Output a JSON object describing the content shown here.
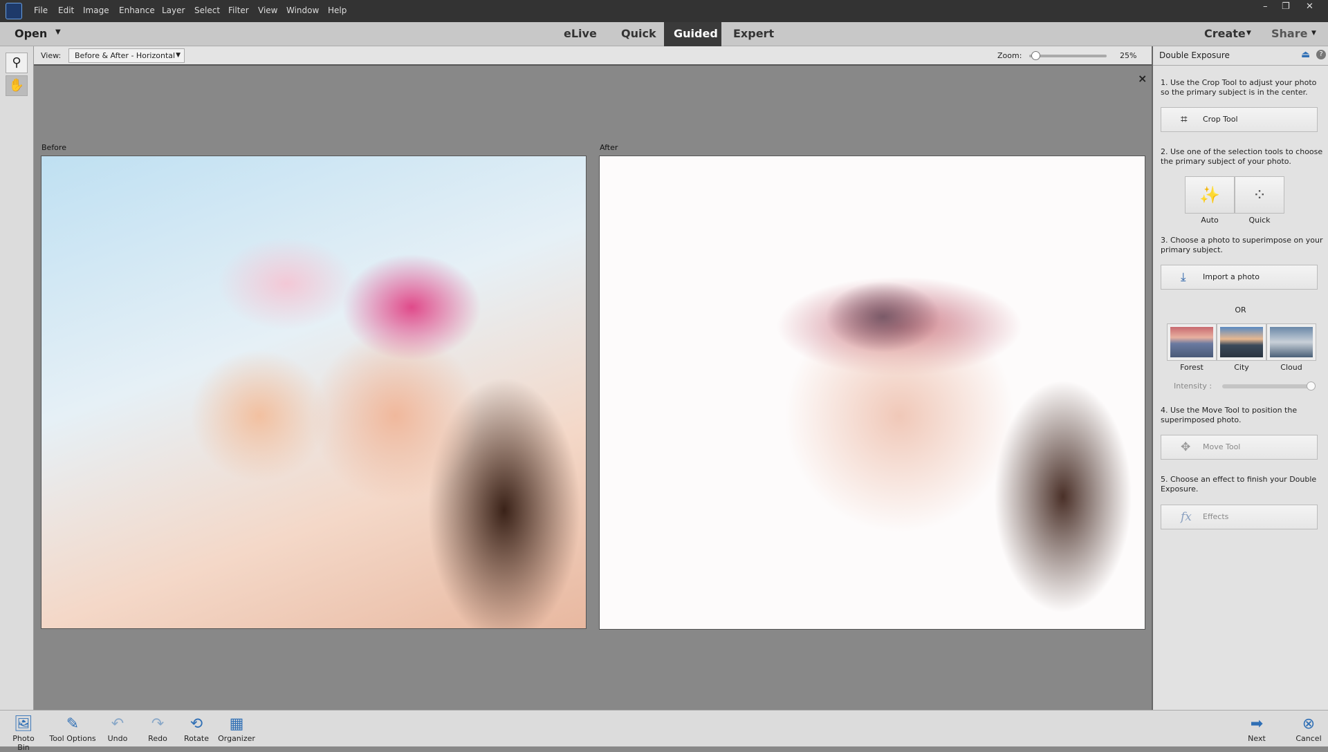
{
  "menu": [
    "File",
    "Edit",
    "Image",
    "Enhance",
    "Layer",
    "Select",
    "Filter",
    "View",
    "Window",
    "Help"
  ],
  "window_controls": [
    "minimize",
    "restore",
    "close"
  ],
  "topbar": {
    "open": "Open",
    "tabs": [
      {
        "label": "eLive"
      },
      {
        "label": "Quick"
      },
      {
        "label": "Guided",
        "active": true
      },
      {
        "label": "Expert"
      }
    ],
    "create": "Create",
    "share": "Share"
  },
  "options": {
    "view_label": "View:",
    "view_value": "Before & After - Horizontal",
    "zoom_label": "Zoom:",
    "zoom_value": "25%",
    "zoom_percent": 25
  },
  "tools": [
    "search-icon",
    "hand-icon"
  ],
  "canvas": {
    "before": "Before",
    "after": "After",
    "close": "×"
  },
  "panel": {
    "title": "Double Exposure",
    "step1": "1. Use the Crop Tool to adjust your photo so the primary subject is in the center.",
    "crop": "Crop Tool",
    "step2": "2. Use one of the selection tools to choose the primary subject of your photo.",
    "auto": "Auto",
    "quick": "Quick",
    "step3": "3. Choose a photo to superimpose on your primary subject.",
    "import": "Import a photo",
    "or": "OR",
    "thumbs": [
      "Forest",
      "City",
      "Cloud"
    ],
    "intensity": "Intensity :",
    "intensity_value": 100,
    "step4": "4. Use the Move Tool to position the superimposed photo.",
    "move": "Move Tool",
    "step5": "5. Choose an effect to finish your Double Exposure.",
    "effects": "Effects"
  },
  "bottom": {
    "photo_bin": "Photo Bin",
    "tool_options": "Tool Options",
    "undo": "Undo",
    "redo": "Redo",
    "rotate": "Rotate",
    "organizer": "Organizer",
    "next": "Next",
    "cancel": "Cancel"
  },
  "colors": {
    "accent": "#2f6fb5",
    "active_tab": "#3a3a3a"
  }
}
